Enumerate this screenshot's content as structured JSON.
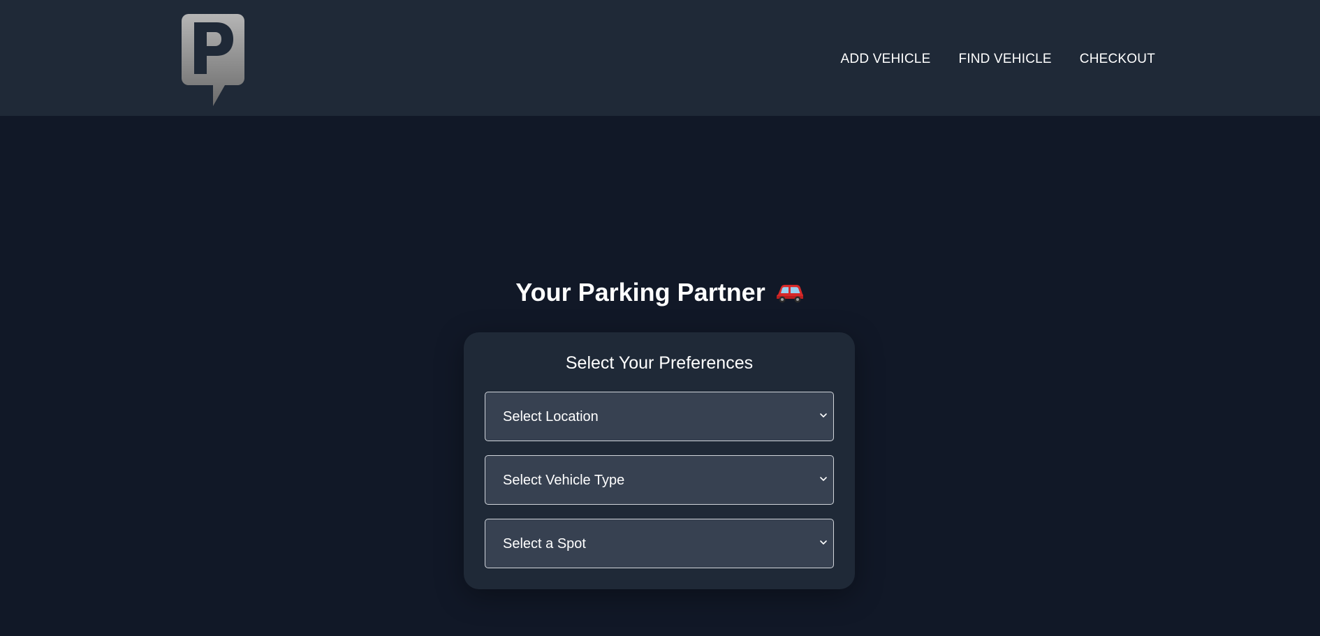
{
  "header": {
    "logo_icon": "parking-p-logo-icon",
    "nav": [
      {
        "label": "ADD VEHICLE"
      },
      {
        "label": "FIND VEHICLE"
      },
      {
        "label": "CHECKOUT"
      }
    ]
  },
  "main": {
    "title": "Your Parking Partner",
    "title_icon": "red-car-emoji-icon",
    "card": {
      "title": "Select Your Preferences",
      "selects": [
        {
          "value": "Select Location"
        },
        {
          "value": "Select Vehicle Type"
        },
        {
          "value": "Select a Spot"
        }
      ]
    }
  },
  "colors": {
    "page_bg": "#111827",
    "header_bg": "#1f2937",
    "card_bg": "#1f2937",
    "select_bg": "#374151",
    "select_border": "#d1d5db",
    "text": "#ffffff"
  }
}
